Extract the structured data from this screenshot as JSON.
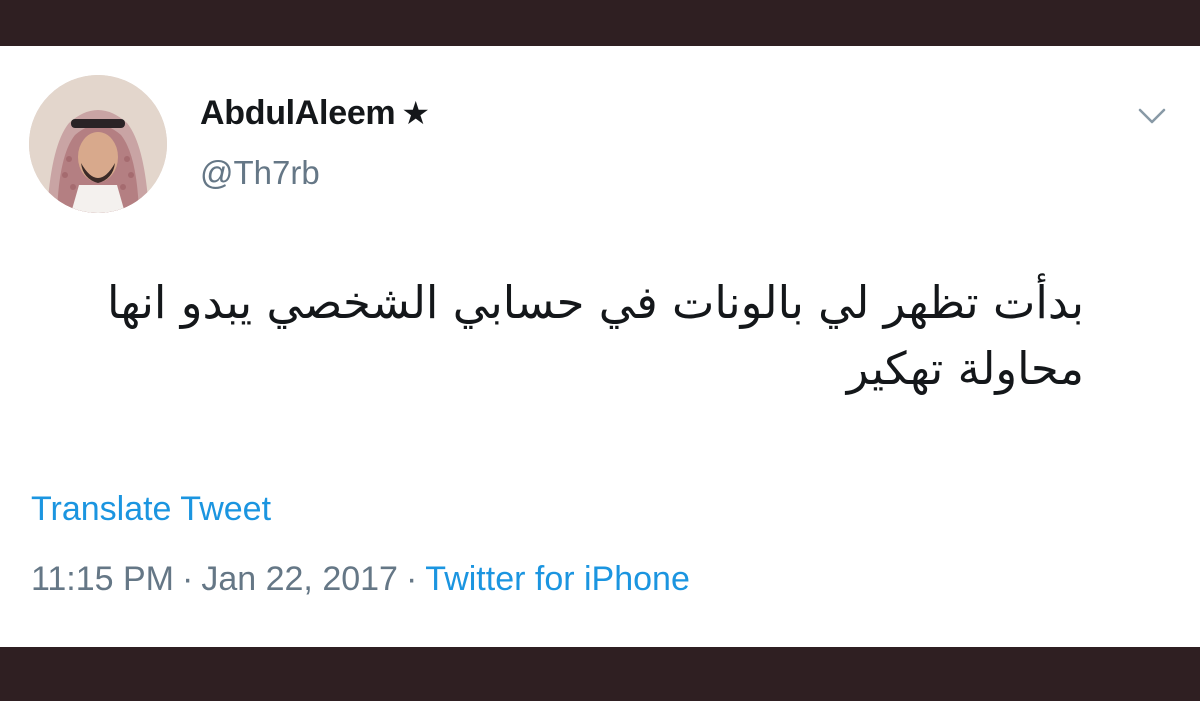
{
  "tweet": {
    "display_name": "AbdulAleem",
    "badge": "★",
    "handle": "@Th7rb",
    "text": "بدأت تظهر لي بالونات في حسابي الشخصي يبدو انها محاولة تهكير",
    "translate_label": "Translate Tweet",
    "time": "11:15 PM",
    "separator": "·",
    "date": "Jan 22, 2017",
    "source": "Twitter for iPhone"
  },
  "icons": {
    "menu": "chevron-down-icon",
    "avatar": "profile-photo"
  },
  "colors": {
    "background_frame": "#2f1f22",
    "card": "#ffffff",
    "text_primary": "#14171a",
    "text_secondary": "#657786",
    "link": "#1b95e0"
  }
}
